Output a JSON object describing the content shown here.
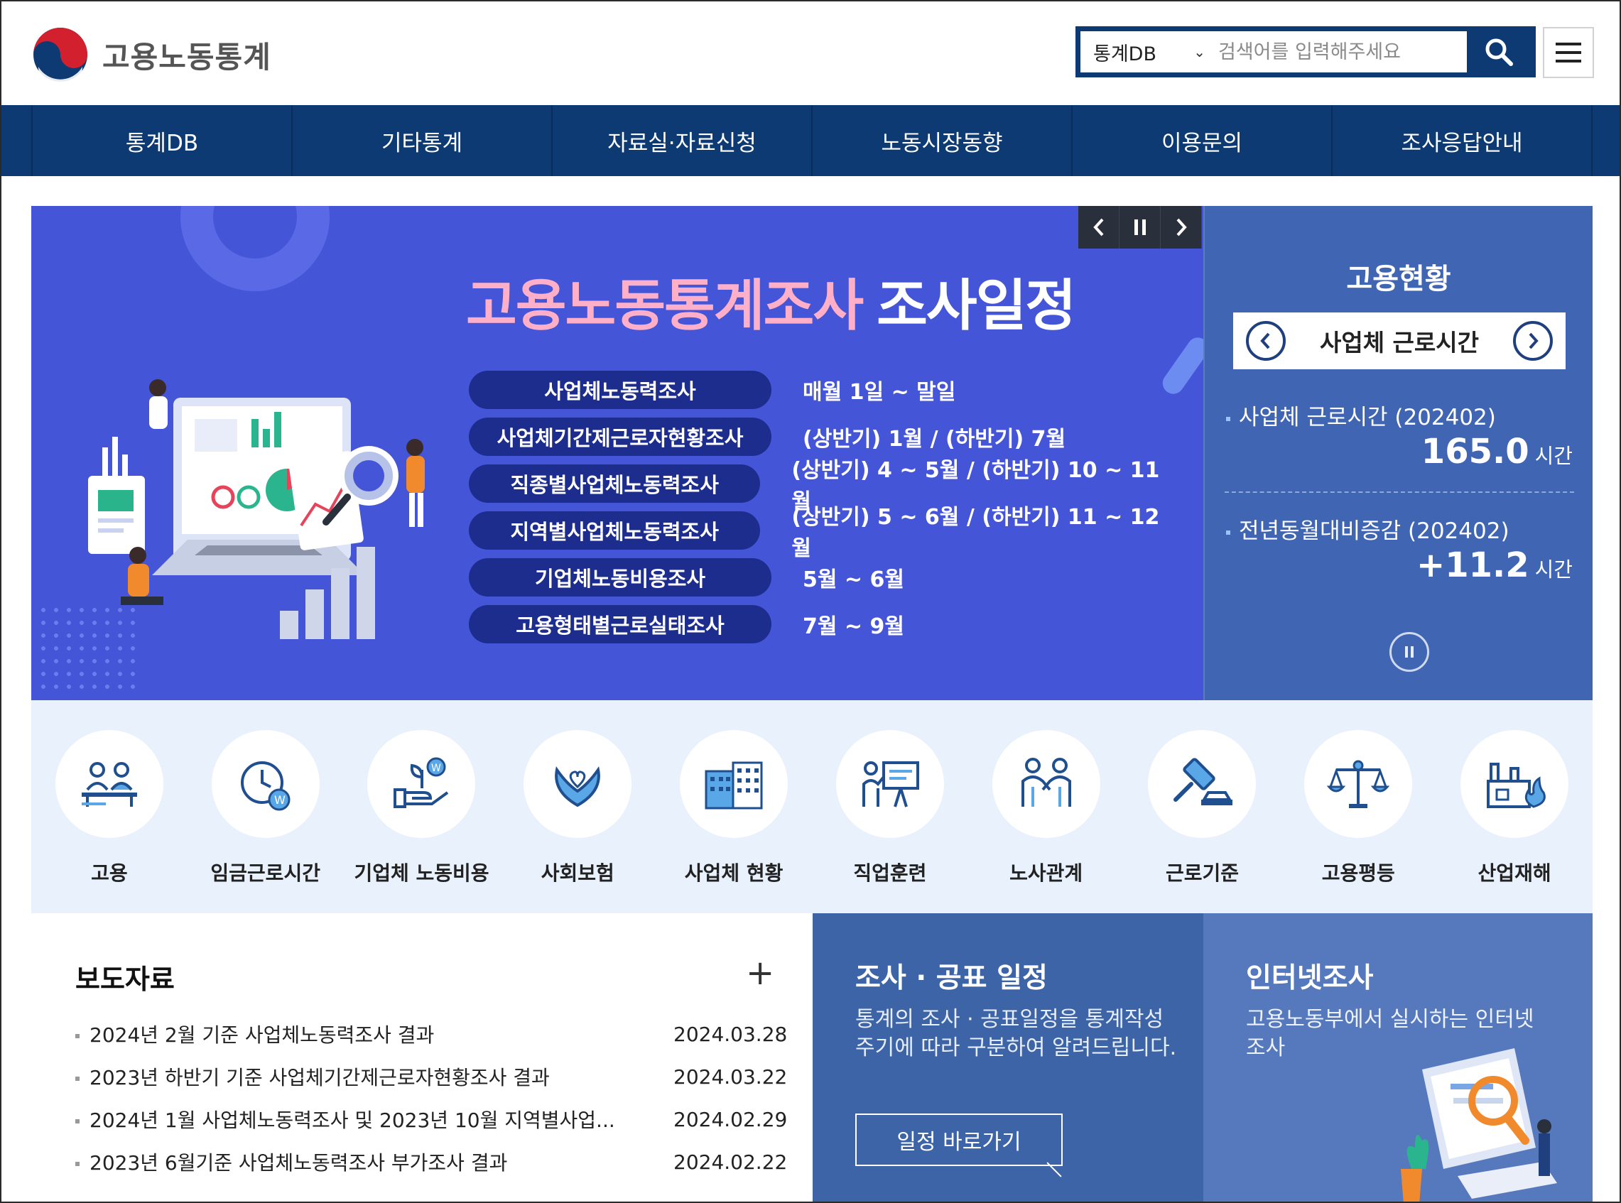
{
  "header": {
    "logo_text": "고용노동통계",
    "search_scope": "통계DB",
    "search_placeholder": "검색어를 입력해주세요"
  },
  "nav": [
    "통계DB",
    "기타통계",
    "자료실·자료신청",
    "노동시장동향",
    "이용문의",
    "조사응답안내"
  ],
  "hero": {
    "title_a": "고용노동통계조사",
    "title_b": "조사일정",
    "schedule": [
      {
        "survey": "사업체노동력조사",
        "period": "매월 1일 ~ 말일"
      },
      {
        "survey": "사업체기간제근로자현황조사",
        "period": "(상반기) 1월 / (하반기) 7월"
      },
      {
        "survey": "직종별사업체노동력조사",
        "period": "(상반기) 4 ~ 5월 / (하반기) 10 ~ 11월"
      },
      {
        "survey": "지역별사업체노동력조사",
        "period": "(상반기) 5 ~ 6월 / (하반기) 11 ~ 12월"
      },
      {
        "survey": "기업체노동비용조사",
        "period": "5월 ~ 6월"
      },
      {
        "survey": "고용형태별근로실태조사",
        "period": "7월 ~ 9월"
      }
    ]
  },
  "employment": {
    "title": "고용현황",
    "selector": "사업체 근로시간",
    "items": [
      {
        "label": "사업체 근로시간 (202402)",
        "value": "165.0",
        "unit": "시간"
      },
      {
        "label": "전년동월대비증감 (202402)",
        "value": "+11.2",
        "unit": "시간"
      }
    ]
  },
  "categories": [
    {
      "label": "고용",
      "icon": "people-desk-icon"
    },
    {
      "label": "임금근로시간",
      "icon": "clock-won-icon"
    },
    {
      "label": "기업체 노동비용",
      "icon": "hand-plant-icon"
    },
    {
      "label": "사회보험",
      "icon": "heart-hands-icon"
    },
    {
      "label": "사업체 현황",
      "icon": "buildings-icon"
    },
    {
      "label": "직업훈련",
      "icon": "training-board-icon"
    },
    {
      "label": "노사관계",
      "icon": "two-people-icon"
    },
    {
      "label": "근로기준",
      "icon": "gavel-icon"
    },
    {
      "label": "고용평등",
      "icon": "scale-icon"
    },
    {
      "label": "산업재해",
      "icon": "factory-fire-icon"
    }
  ],
  "press": {
    "title": "보도자료",
    "items": [
      {
        "title": "2024년 2월 기준 사업체노동력조사 결과",
        "date": "2024.03.28"
      },
      {
        "title": "2023년 하반기 기준 사업체기간제근로자현황조사 결과",
        "date": "2024.03.22"
      },
      {
        "title": "2024년 1월 사업체노동력조사 및 2023년 10월 지역별사업...",
        "date": "2024.02.29"
      },
      {
        "title": "2023년 6월기준 사업체노동력조사 부가조사 결과",
        "date": "2024.02.22"
      }
    ]
  },
  "schedule_box": {
    "title": "조사 · 공표 일정",
    "desc": "통계의 조사 · 공표일정을 통계작성 주기에 따라 구분하여 알려드립니다.",
    "button": "일정 바로가기"
  },
  "internet_box": {
    "title": "인터넷조사",
    "desc": "고용노동부에서 실시하는 인터넷조사"
  },
  "colors": {
    "navy": "#0d3a73",
    "hero_bg": "#4455d8",
    "panel_blue": "#3f65b3",
    "category_bg": "#e8f1fc",
    "title_pink": "#ffb0c8"
  }
}
